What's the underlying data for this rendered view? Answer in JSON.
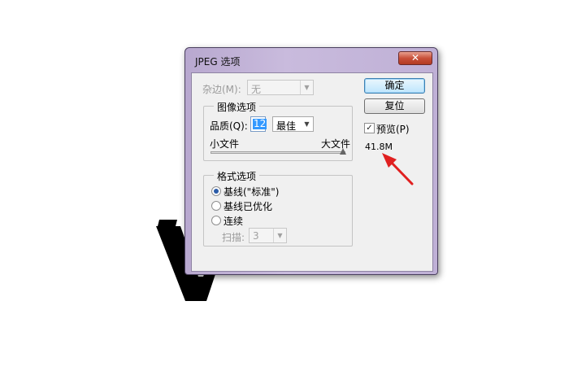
{
  "dialog": {
    "title": "JPEG 选项",
    "close_symbol": "✕"
  },
  "matte": {
    "label": "杂边(M):",
    "value": "无"
  },
  "image_options": {
    "group_title": "图像选项",
    "quality_label": "品质(Q):",
    "quality_value": "12",
    "quality_preset": "最佳",
    "small_file_label": "小文件",
    "large_file_label": "大文件",
    "slider_fraction": 1.0
  },
  "format_options": {
    "group_title": "格式选项",
    "options": [
      {
        "label": "基线(\"标准\")",
        "selected": true
      },
      {
        "label": "基线已优化",
        "selected": false
      },
      {
        "label": "连续",
        "selected": false
      }
    ],
    "scans_label": "扫描:",
    "scans_value": "3"
  },
  "buttons": {
    "ok": "确定",
    "reset": "复位"
  },
  "preview": {
    "label": "预览(P)",
    "checked": true,
    "file_size": "41.8M"
  },
  "colors": {
    "annotation_arrow": "#e02020",
    "title_gradient": "#c9bbdd"
  }
}
